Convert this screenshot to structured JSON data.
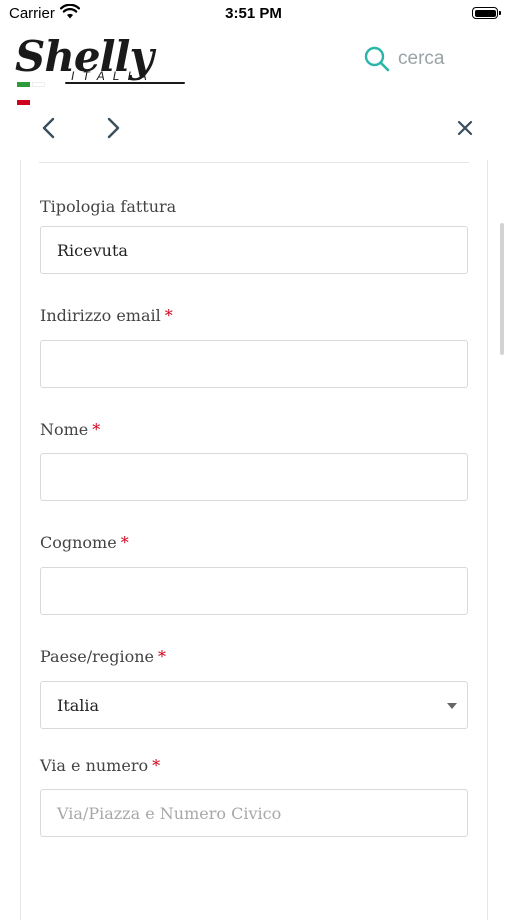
{
  "status_bar": {
    "carrier": "Carrier",
    "time": "3:51 PM"
  },
  "header": {
    "logo_text": "Shelly",
    "logo_subtext": "ITALIA",
    "search_label": "cerca",
    "accent_color": "#2bb5a8",
    "flag_colors": [
      "#2e9b3a",
      "#ffffff",
      "#d0021b"
    ]
  },
  "nav": {
    "back_icon": "chevron-left-icon",
    "forward_icon": "chevron-right-icon",
    "close_icon": "close-icon"
  },
  "form": {
    "required_marker": "*",
    "invoice_type": {
      "label": "Tipologia fattura",
      "value": "Ricevuta"
    },
    "email": {
      "label": "Indirizzo email",
      "value": ""
    },
    "first_name": {
      "label": "Nome",
      "value": ""
    },
    "last_name": {
      "label": "Cognome",
      "value": ""
    },
    "country": {
      "label": "Paese/regione",
      "value": "Italia"
    },
    "street": {
      "label": "Via e numero",
      "placeholder": "Via/Piazza e Numero Civico"
    }
  }
}
